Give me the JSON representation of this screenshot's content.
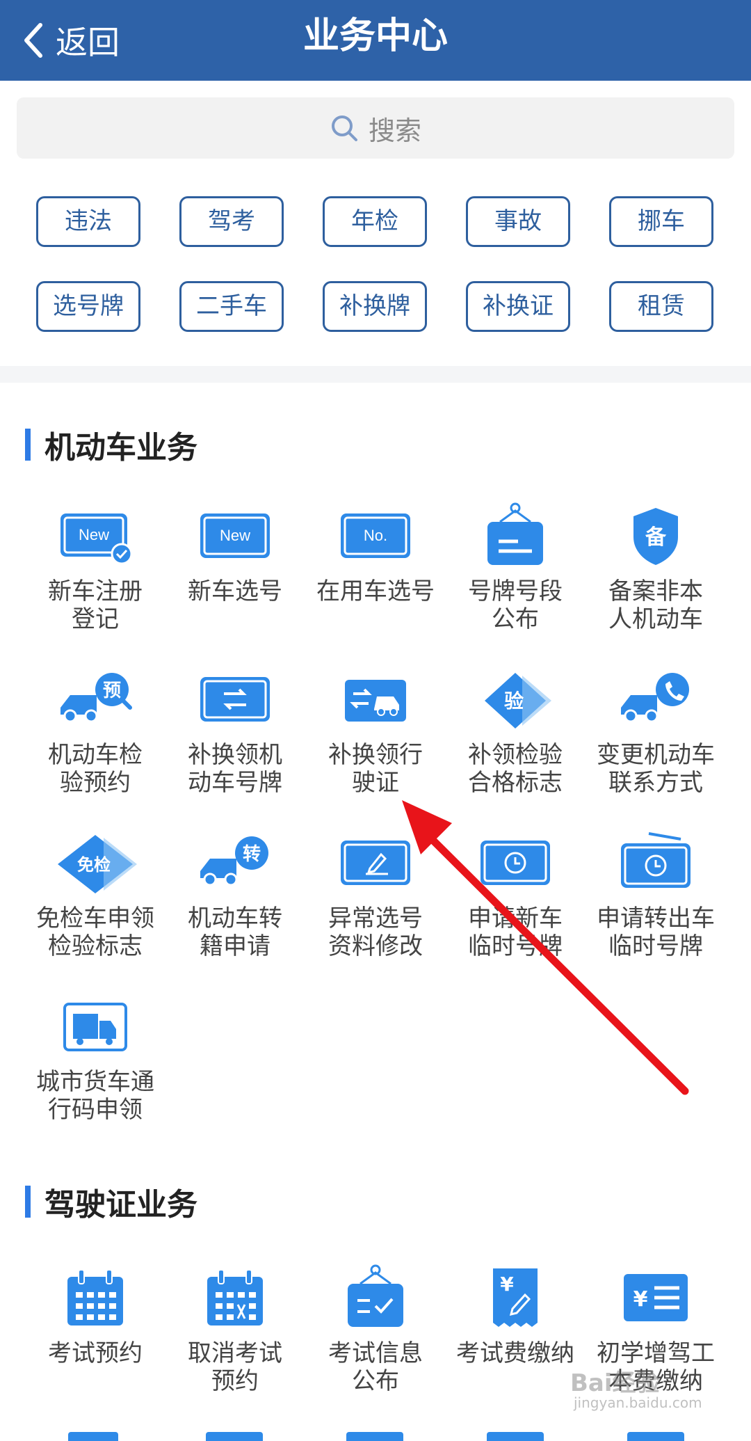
{
  "header": {
    "back_label": "返回",
    "title": "业务中心"
  },
  "search": {
    "placeholder": "搜索"
  },
  "quick_tags": [
    "违法",
    "驾考",
    "年检",
    "事故",
    "挪车",
    "选号牌",
    "二手车",
    "补换牌",
    "补换证",
    "租赁"
  ],
  "sections": [
    {
      "title": "机动车业务",
      "items": [
        {
          "label1": "新车注册",
          "label2": "登记",
          "icon": "new-plate-check-icon"
        },
        {
          "label1": "新车选号",
          "label2": "",
          "icon": "new-plate-icon"
        },
        {
          "label1": "在用车选号",
          "label2": "",
          "icon": "no-plate-icon"
        },
        {
          "label1": "号牌号段",
          "label2": "公布",
          "icon": "hanging-sign-icon"
        },
        {
          "label1": "备案非本",
          "label2": "人机动车",
          "icon": "shield-bei-icon"
        },
        {
          "label1": "机动车检",
          "label2": "验预约",
          "icon": "truck-appointment-icon"
        },
        {
          "label1": "补换领机",
          "label2": "动车号牌",
          "icon": "plate-exchange-icon"
        },
        {
          "label1": "补换领行",
          "label2": "驶证",
          "icon": "car-exchange-icon"
        },
        {
          "label1": "补领检验",
          "label2": "合格标志",
          "icon": "diamond-yan-icon"
        },
        {
          "label1": "变更机动车",
          "label2": "联系方式",
          "icon": "truck-phone-icon"
        },
        {
          "label1": "免检车申领",
          "label2": "检验标志",
          "icon": "diamond-mianjian-icon"
        },
        {
          "label1": "机动车转",
          "label2": "籍申请",
          "icon": "truck-transfer-icon"
        },
        {
          "label1": "异常选号",
          "label2": "资料修改",
          "icon": "plate-edit-icon"
        },
        {
          "label1": "申请新车",
          "label2": "临时号牌",
          "icon": "plate-clock-icon"
        },
        {
          "label1": "申请转出车",
          "label2": "临时号牌",
          "icon": "plate-clock-out-icon"
        },
        {
          "label1": "城市货车通",
          "label2": "行码申领",
          "icon": "truck-pass-icon"
        }
      ]
    },
    {
      "title": "驾驶证业务",
      "items": [
        {
          "label1": "考试预约",
          "label2": "",
          "icon": "calendar-icon"
        },
        {
          "label1": "取消考试",
          "label2": "预约",
          "icon": "calendar-cancel-icon"
        },
        {
          "label1": "考试信息",
          "label2": "公布",
          "icon": "board-check-icon"
        },
        {
          "label1": "考试费缴纳",
          "label2": "",
          "icon": "yen-receipt-icon"
        },
        {
          "label1": "初学增驾工",
          "label2": "本费缴纳",
          "icon": "yen-list-icon"
        }
      ]
    }
  ],
  "watermark": {
    "main": "Bai经验",
    "sub": "jingyan.baidu.com"
  },
  "colors": {
    "header_bg": "#2e62a8",
    "icon_blue": "#2e8ae8",
    "tag_border": "#2e5f9e",
    "arrow": "#e8141a"
  }
}
